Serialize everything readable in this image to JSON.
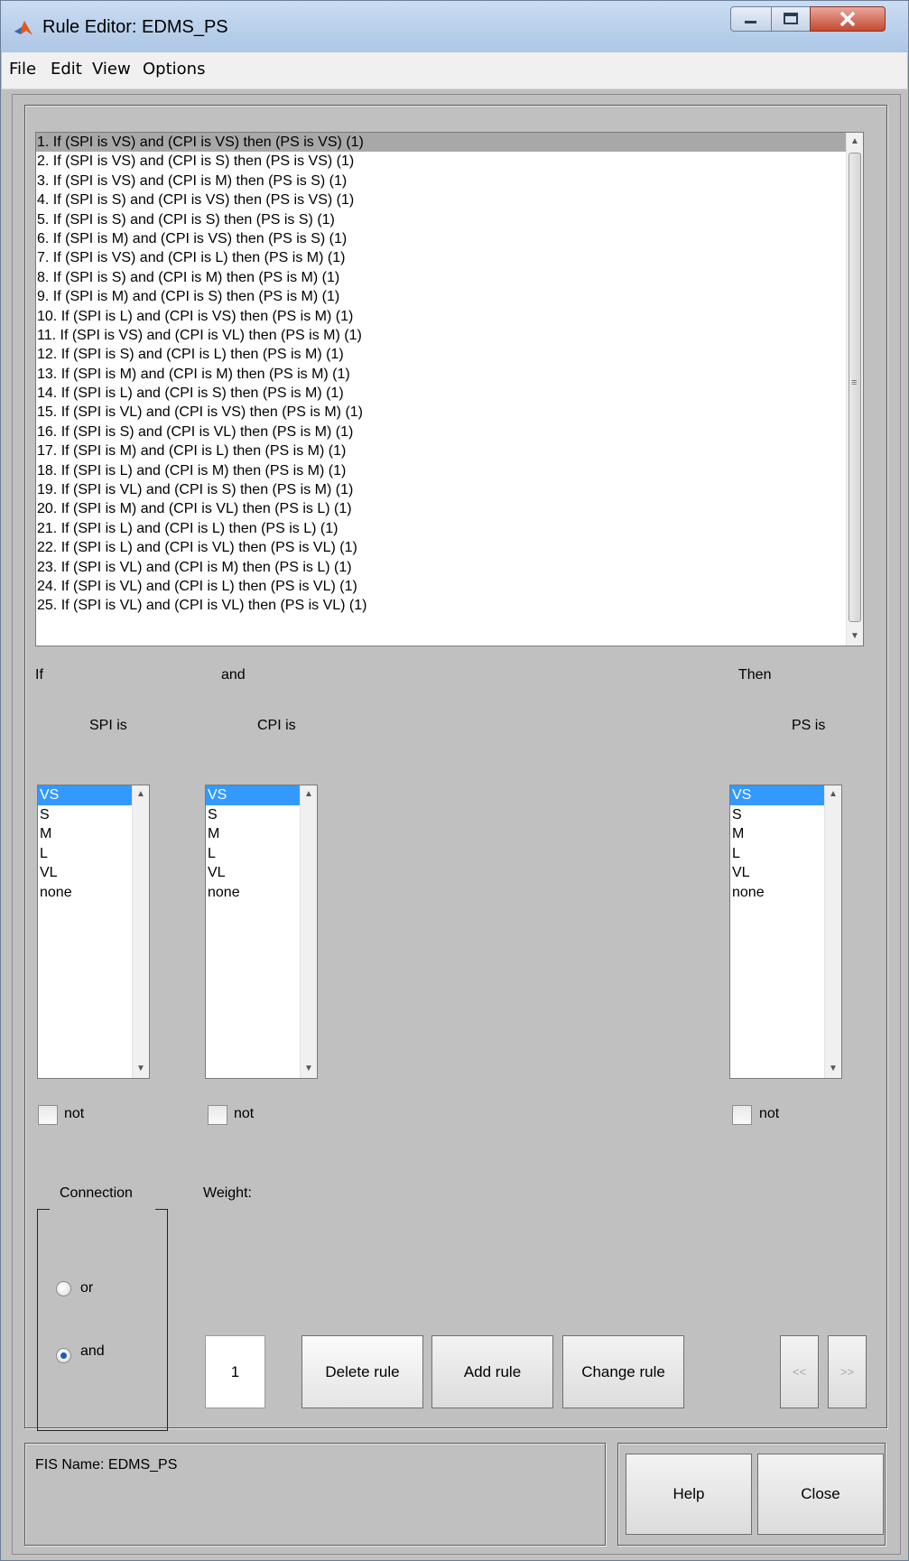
{
  "window": {
    "title": "Rule Editor: EDMS_PS"
  },
  "menu": [
    "File",
    "Edit",
    "View",
    "Options"
  ],
  "rules": [
    "1. If (SPI is VS) and (CPI is VS) then (PS is VS) (1)",
    "2. If (SPI is VS) and (CPI is S) then (PS is VS) (1)",
    "3. If (SPI is VS) and (CPI is M) then (PS is S) (1)",
    "4. If (SPI is S) and (CPI is VS) then (PS is VS) (1)",
    "5. If (SPI is S) and (CPI is S) then (PS is S) (1)",
    "6. If (SPI is M) and (CPI is VS) then (PS is S) (1)",
    "7. If (SPI is VS) and (CPI is L) then (PS is M) (1)",
    "8. If (SPI is S) and (CPI is M) then (PS is M) (1)",
    "9. If (SPI is M) and (CPI is S) then (PS is M) (1)",
    "10. If (SPI is L) and (CPI is VS) then (PS is M) (1)",
    "11. If (SPI is VS) and (CPI is VL) then (PS is M) (1)",
    "12. If (SPI is S) and (CPI is L) then (PS is M) (1)",
    "13. If (SPI is M) and (CPI is M) then (PS is M) (1)",
    "14. If (SPI is L) and (CPI is S) then (PS is M) (1)",
    "15. If (SPI is VL) and (CPI is VS) then (PS is M) (1)",
    "16. If (SPI is S) and (CPI is VL) then (PS is M) (1)",
    "17. If (SPI is M) and (CPI is L) then (PS is M) (1)",
    "18. If (SPI is L) and (CPI is M) then (PS is M) (1)",
    "19. If (SPI is VL) and (CPI is S) then (PS is M) (1)",
    "20. If (SPI is M) and (CPI is VL) then (PS is L) (1)",
    "21. If (SPI is L) and (CPI is L) then (PS is L) (1)",
    "22. If (SPI is L) and (CPI is VL) then (PS is VL) (1)",
    "23. If (SPI is VL) and (CPI is M) then (PS is L) (1)",
    "24. If (SPI is VL) and (CPI is L) then (PS is VL) (1)",
    "25. If (SPI is VL) and (CPI is VL) then (PS is VL) (1)"
  ],
  "selected_rule_index": 0,
  "labels": {
    "if": "If",
    "and": "and",
    "then": "Then"
  },
  "inputs": [
    {
      "title": "SPI is",
      "options": [
        "VS",
        "S",
        "M",
        "L",
        "VL",
        "none"
      ],
      "selected": "VS",
      "not_label": "not"
    },
    {
      "title": "CPI is",
      "options": [
        "VS",
        "S",
        "M",
        "L",
        "VL",
        "none"
      ],
      "selected": "VS",
      "not_label": "not"
    }
  ],
  "output": {
    "title": "PS is",
    "options": [
      "VS",
      "S",
      "M",
      "L",
      "VL",
      "none"
    ],
    "selected": "VS",
    "not_label": "not"
  },
  "connection": {
    "title": "Connection",
    "options": [
      "or",
      "and"
    ],
    "selected": "and"
  },
  "weight": {
    "label": "Weight:",
    "value": "1"
  },
  "buttons": {
    "delete": "Delete rule",
    "add": "Add rule",
    "change": "Change rule",
    "prev": "<<",
    "next": ">>",
    "help": "Help",
    "close": "Close"
  },
  "status": "FIS Name: EDMS_PS",
  "colors": {
    "selection": "#3399ff",
    "rule_selection": "#a8a8a8",
    "panel": "#c0c0c0"
  }
}
